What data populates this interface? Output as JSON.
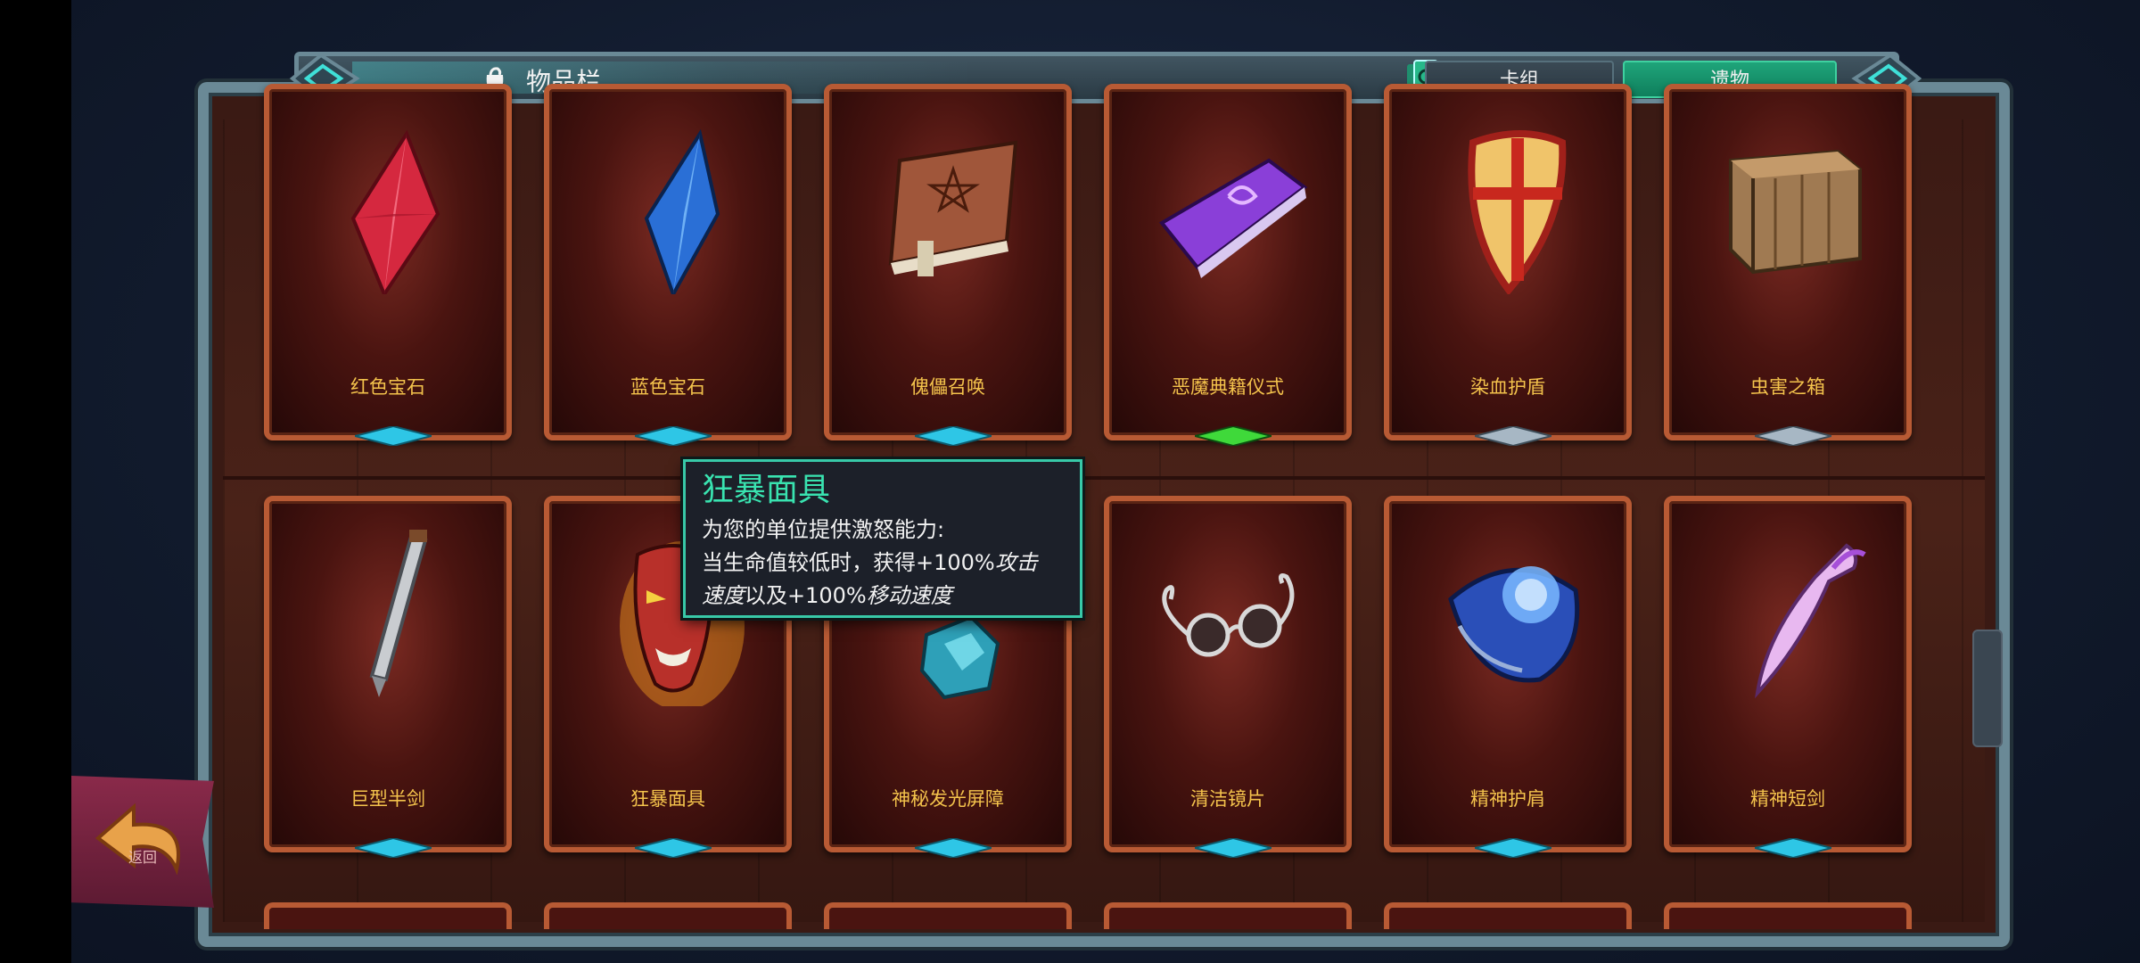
{
  "header": {
    "title": "物品栏",
    "tabs": [
      {
        "label": "卡组",
        "active": false
      },
      {
        "label": "遗物",
        "active": true
      }
    ]
  },
  "items": [
    {
      "name": "红色宝石",
      "icon": "red-gem-icon",
      "rarity_color": "#2ec6e6"
    },
    {
      "name": "蓝色宝石",
      "icon": "blue-gem-icon",
      "rarity_color": "#2ec6e6"
    },
    {
      "name": "傀儡召唤",
      "icon": "brown-book-icon",
      "rarity_color": "#2ec6e6"
    },
    {
      "name": "恶魔典籍仪式",
      "icon": "purple-book-icon",
      "rarity_color": "#3fd93a"
    },
    {
      "name": "染血护盾",
      "icon": "shield-icon",
      "rarity_color": "#a7b7c4"
    },
    {
      "name": "虫害之箱",
      "icon": "crate-icon",
      "rarity_color": "#a7b7c4"
    },
    {
      "name": "巨型半剑",
      "icon": "greatsword-icon",
      "rarity_color": "#2ec6e6"
    },
    {
      "name": "狂暴面具",
      "icon": "mask-icon",
      "rarity_color": "#2ec6e6"
    },
    {
      "name": "神秘发光屏障",
      "icon": "crystal-icon",
      "rarity_color": "#2ec6e6"
    },
    {
      "name": "清洁镜片",
      "icon": "glasses-icon",
      "rarity_color": "#2ec6e6"
    },
    {
      "name": "精神护肩",
      "icon": "pauldron-icon",
      "rarity_color": "#2ec6e6"
    },
    {
      "name": "精神短剑",
      "icon": "dagger-icon",
      "rarity_color": "#2ec6e6"
    }
  ],
  "tooltip": {
    "title": "狂暴面具",
    "line1": "为您的单位提供激怒能力:",
    "line2a": "当生命值较低时，获得+100%",
    "line2b": "攻击",
    "line3a": "速度",
    "line3b": "以及+100%",
    "line3c": "移动速度"
  },
  "back": {
    "label": "返回"
  },
  "colors": {
    "accent": "#39e3b0",
    "label": "#f4c34c",
    "frame": "#6a8996",
    "card_border": "#b85a34"
  }
}
